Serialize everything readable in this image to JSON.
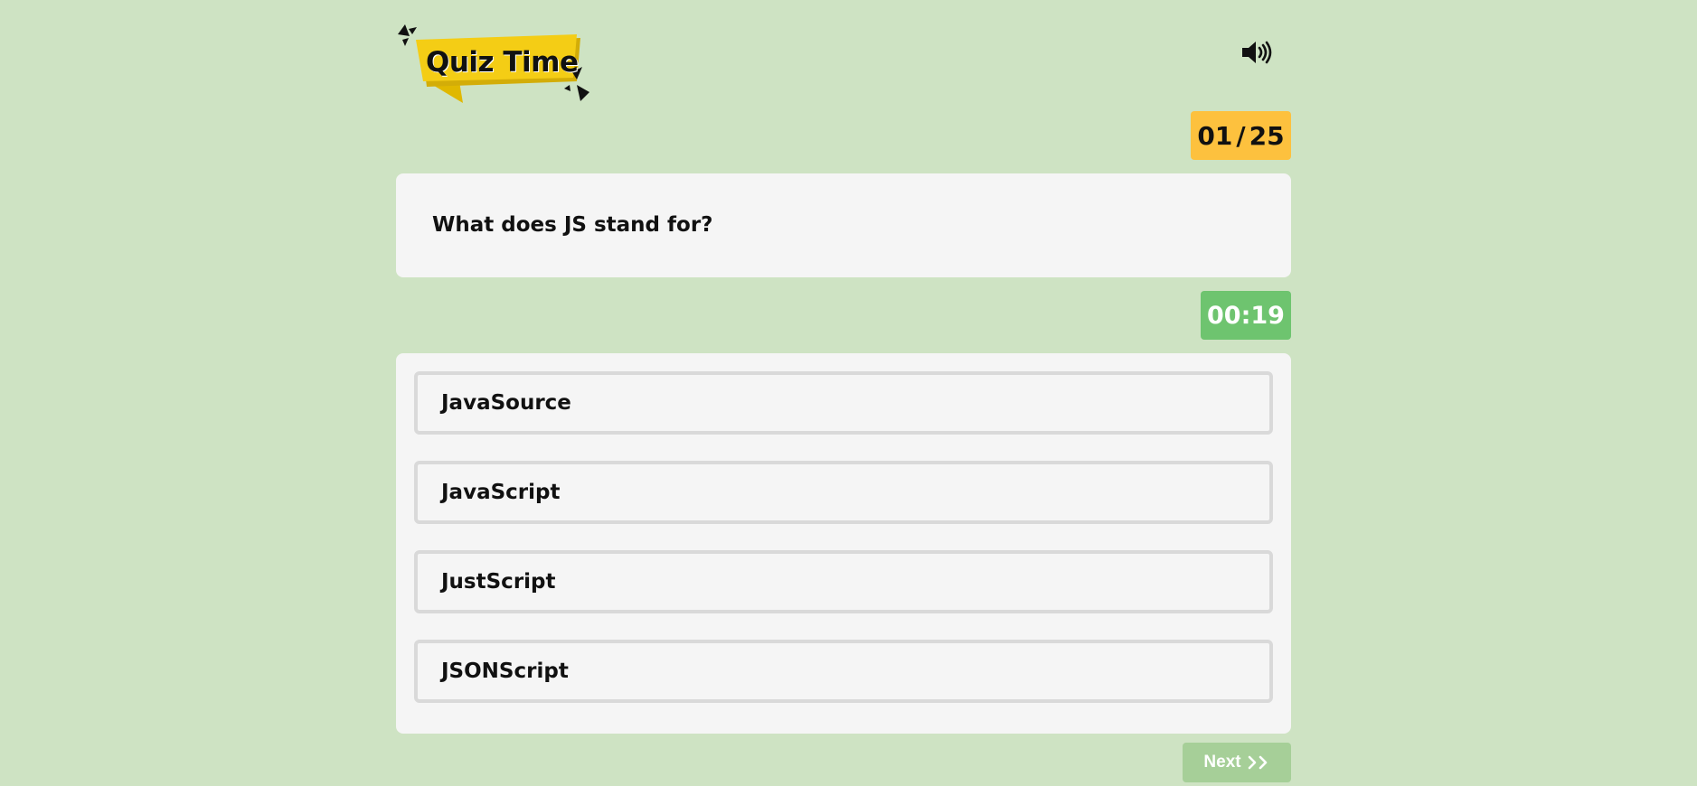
{
  "header": {
    "logo_text": "Quiz Time",
    "logo_icon": "quiz-time-banner",
    "volume_icon": "speaker-volume-icon"
  },
  "progress": {
    "current": "01",
    "separator": "/",
    "total": "25"
  },
  "question": {
    "text": "What does JS stand for?"
  },
  "timer": {
    "value": "00:19"
  },
  "options": [
    {
      "label": "JavaSource"
    },
    {
      "label": "JavaScript"
    },
    {
      "label": "JustScript"
    },
    {
      "label": "JSONScript"
    }
  ],
  "footer": {
    "next_label": "Next",
    "next_icon": "double-chevron-right-icon"
  },
  "colors": {
    "background": "#cee3c3",
    "card": "#f5f5f5",
    "counter": "#fdc13e",
    "timer": "#6ec46f",
    "next_button": "#a6cf98",
    "logo_banner": "#f4cd15"
  }
}
